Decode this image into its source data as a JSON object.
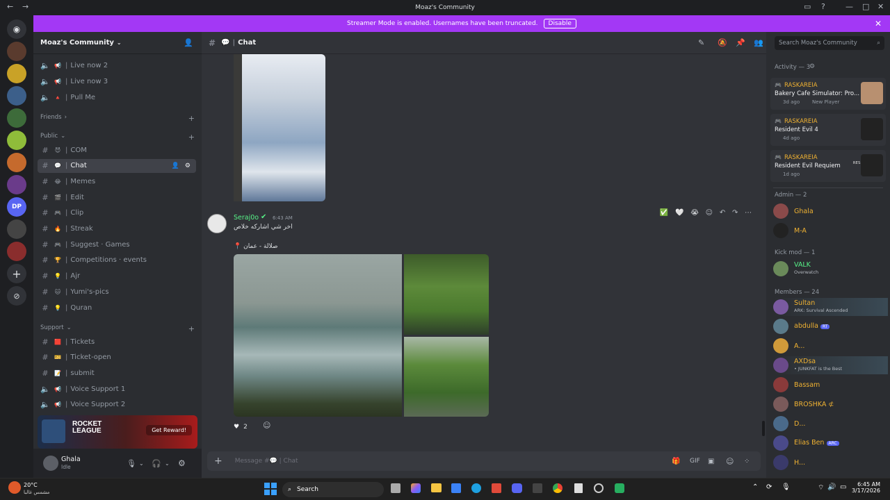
{
  "window": {
    "title": "Moaz's Community"
  },
  "banner": {
    "text": "Streamer Mode is enabled. Usernames have been truncated.",
    "button": "Disable"
  },
  "server": {
    "name": "Moaz's Community"
  },
  "channels_top": [
    {
      "type": "voice",
      "emoji": "📢",
      "name": "Live now 2"
    },
    {
      "type": "voice",
      "emoji": "📢",
      "name": "Live now 3"
    },
    {
      "type": "voice",
      "emoji": "🔺",
      "name": "Pull Me"
    }
  ],
  "categories": {
    "friends": "Friends",
    "public": "Public",
    "support": "Support"
  },
  "channels_public": [
    {
      "emoji": "😈",
      "name": "COM",
      "active": false
    },
    {
      "emoji": "💬",
      "name": "Chat",
      "active": true
    },
    {
      "emoji": "😂",
      "name": "Memes",
      "active": false
    },
    {
      "emoji": "🎬",
      "name": "Edit",
      "active": false
    },
    {
      "emoji": "🎮",
      "name": "Clip",
      "active": false
    },
    {
      "emoji": "🔥",
      "name": "Streak",
      "active": false
    },
    {
      "emoji": "🎮",
      "name": "Suggest · Games",
      "active": false
    },
    {
      "emoji": "🏆",
      "name": "Competitions · events",
      "active": false
    },
    {
      "emoji": "💡",
      "name": "Ajr",
      "active": false
    },
    {
      "emoji": "🐱",
      "name": "Yumi's-pics",
      "active": false
    },
    {
      "emoji": "💡",
      "name": "Quran",
      "active": false
    }
  ],
  "channels_support": [
    {
      "type": "text",
      "emoji": "🟥",
      "name": "Tickets"
    },
    {
      "type": "text",
      "emoji": "🎫",
      "name": "Ticket-open"
    },
    {
      "type": "text",
      "emoji": "📝",
      "name": "submit"
    },
    {
      "type": "voice",
      "emoji": "📢",
      "name": "Voice Support 1"
    },
    {
      "type": "voice",
      "emoji": "📢",
      "name": "Voice Support 2"
    }
  ],
  "promo": {
    "logo_line1": "ROCKET",
    "logo_line2": "LEAGUE",
    "button": "Get Reward!"
  },
  "user": {
    "name": "Ghala",
    "status": "Idle"
  },
  "channel_header": {
    "emoji": "💬",
    "name": "Chat"
  },
  "message": {
    "author": "Seraj0o",
    "time": "6:43 AM",
    "text": "اخر شي اشاركه خلاص",
    "location": "📍 صلالة - عمان",
    "reaction_count": "2"
  },
  "composer": {
    "placeholder": "Message #💬 | Chat"
  },
  "search": {
    "placeholder": "Search Moaz's Community"
  },
  "activity": {
    "title": "Activity — 3",
    "items": [
      {
        "user": "RASKAREIA",
        "game": "Bakery Cafe Simulator: Pro...",
        "meta": "3d ago",
        "tag": "New Player"
      },
      {
        "user": "RASKAREIA",
        "game": "Resident Evil 4",
        "meta": "4d ago",
        "tag": ""
      },
      {
        "user": "RASKAREIA",
        "game": "Resident Evil Requiem",
        "meta": "1d ago",
        "tag": "RESIDENT EVIL"
      }
    ]
  },
  "member_groups": {
    "admin": "Admin — 2",
    "kickmod": "Kick mod — 1",
    "members": "Members — 24"
  },
  "admins": [
    {
      "name": "Ghala",
      "sub": "",
      "color": "#f0b232"
    },
    {
      "name": "M-A",
      "sub": "",
      "color": "#f0b232"
    }
  ],
  "kickmods": [
    {
      "name": "VALK",
      "sub": "Overwatch",
      "color": "#57f287"
    }
  ],
  "members": [
    {
      "name": "Sultan",
      "sub": "ARK: Survival Ascended",
      "color": "#f0b232"
    },
    {
      "name": "abdulla",
      "sub": "",
      "badge": "RT",
      "color": "#f0b232"
    },
    {
      "name": "A...",
      "sub": "",
      "color": "#f0b232"
    },
    {
      "name": "AXDsa",
      "sub": "• JUNKFAT is the Best",
      "color": "#f0b232"
    },
    {
      "name": "Bassam",
      "sub": "",
      "color": "#f0b232"
    },
    {
      "name": "BROSHKA ⊄",
      "sub": "",
      "color": "#f0b232"
    },
    {
      "name": "D...",
      "sub": "",
      "color": "#f0b232"
    },
    {
      "name": "Elias Ben",
      "sub": "",
      "badge": "ARC",
      "color": "#f0b232"
    },
    {
      "name": "H...",
      "sub": "",
      "color": "#f0b232"
    }
  ],
  "taskbar": {
    "weather_temp": "20°C",
    "weather_desc": "مشمس غالبا",
    "search": "Search",
    "time": "6:45 AM",
    "date": "3/17/2026"
  }
}
